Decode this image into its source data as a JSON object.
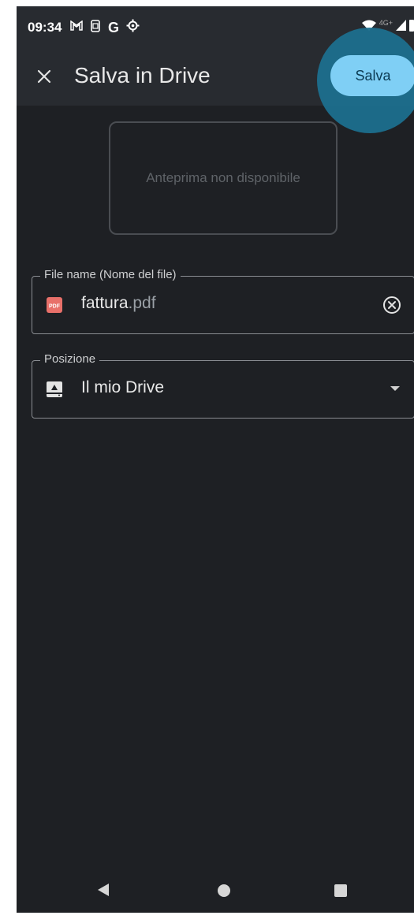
{
  "status_bar": {
    "time": "09:34",
    "left_icons": [
      "gmail-icon",
      "screenshot-icon",
      "google-icon",
      "settings-icon"
    ],
    "right_icons": [
      "wifi-icon",
      "lte-4g-icon",
      "signal-icon",
      "battery-icon"
    ],
    "network_label": "4G+"
  },
  "app_bar": {
    "close_icon": "close-icon",
    "title": "Salva in Drive",
    "save_label": "Salva"
  },
  "preview": {
    "text": "Anteprima non disponibile"
  },
  "file_name_field": {
    "label": "File name (Nome del file)",
    "icon": "pdf-file-icon",
    "icon_text": "PDF",
    "value_name": "fattura",
    "value_ext": ".pdf",
    "clear_icon": "clear-circle-icon"
  },
  "location_field": {
    "label": "Posizione",
    "icon": "drive-icon",
    "value": "Il mio Drive",
    "dropdown_icon": "dropdown-arrow-icon"
  },
  "nav_bar": {
    "back_icon": "back-icon",
    "home_icon": "home-icon",
    "recents_icon": "recents-icon"
  },
  "colors": {
    "background": "#1e2024",
    "app_bar": "#282b30",
    "save_button": "#7fcff5",
    "save_highlight": "#1c6f8e",
    "pdf_red": "#e8706a"
  }
}
